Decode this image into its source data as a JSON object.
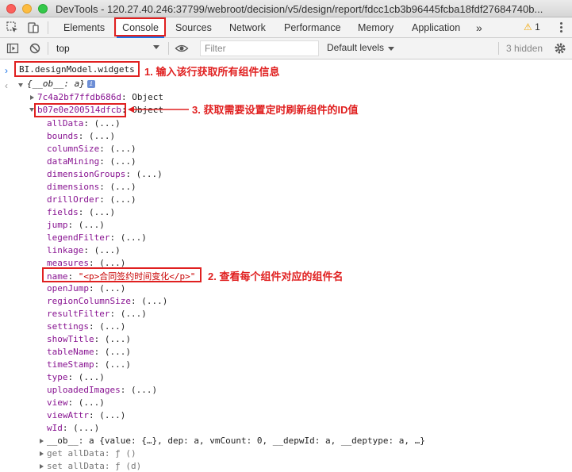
{
  "window": {
    "title": "DevTools - 120.27.40.246:37799/webroot/decision/v5/design/report/fdcc1cb3b96445fcba18fdf27684740b..."
  },
  "tabs": [
    {
      "label": "Elements"
    },
    {
      "label": "Console"
    },
    {
      "label": "Sources"
    },
    {
      "label": "Network"
    },
    {
      "label": "Performance"
    },
    {
      "label": "Memory"
    },
    {
      "label": "Application"
    },
    {
      "label": "»"
    }
  ],
  "warnings": {
    "count": "1"
  },
  "toolbar": {
    "context": "top",
    "filter_placeholder": "Filter",
    "levels": "Default levels",
    "hidden": "3 hidden"
  },
  "console": {
    "command": "BI.designModel.widgets",
    "root": "{__ob__: a}",
    "widget1_id": "7c4a2bf7ffdb686d",
    "widget1_type": ": Object",
    "widget2_id": "b07e0e200514dfcb",
    "widget2_type": ": Object",
    "props": [
      "allData",
      "bounds",
      "columnSize",
      "dataMining",
      "dimensionGroups",
      "dimensions",
      "drillOrder",
      "fields",
      "jump",
      "legendFilter",
      "linkage",
      "measures"
    ],
    "name_key": "name",
    "name_value": "\"<p>合同签约时间变化</p>\"",
    "props2": [
      "openJump",
      "regionColumnSize",
      "resultFilter",
      "settings",
      "showTitle",
      "tableName",
      "timeStamp",
      "type",
      "uploadedImages",
      "view",
      "viewAttr",
      "wId"
    ],
    "prop_value": ": (...)",
    "ob_line": "__ob__: a {value: {…}, dep: a, vmCount: 0, __depwId: a, __deptype: a, …}",
    "getter": "get allData: ƒ ()",
    "setter": "set allData: ƒ (d)"
  },
  "annotations": {
    "a1": "1. 输入该行获取所有组件信息",
    "a2": "2. 查看每个组件对应的组件名",
    "a3": "3. 获取需要设置定时刷新组件的ID值"
  },
  "colors": {
    "annotation": "#e02020",
    "active_tab": "#1a73e8"
  }
}
